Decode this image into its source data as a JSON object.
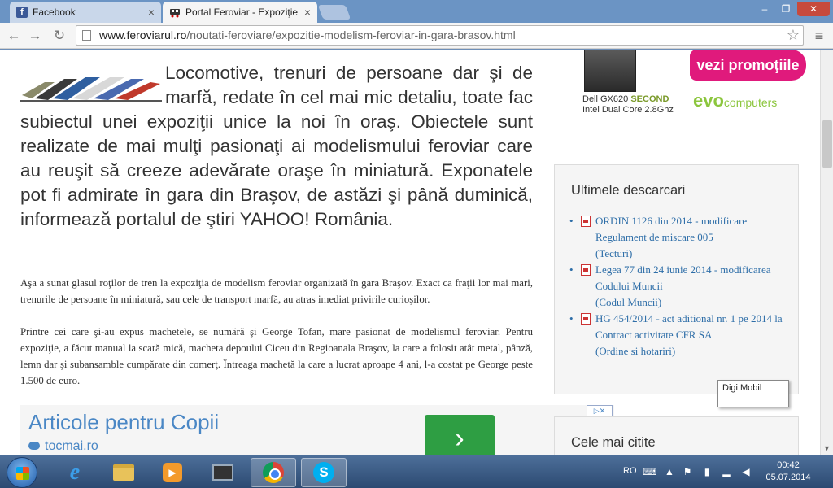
{
  "browser": {
    "tabs": [
      {
        "title": "Facebook",
        "close": "×"
      },
      {
        "title": "Portal Feroviar - Expoziţie",
        "close": "×"
      }
    ],
    "url_domain": "www.feroviarul.ro",
    "url_path": "/noutati-feroviare/expozitie-modelism-feroviar-in-gara-brasov.html",
    "window_controls": {
      "min": "–",
      "max": "❐",
      "close": "✕"
    }
  },
  "article": {
    "lead": "Locomotive, trenuri de persoane dar şi de marfă, redate în cel mai mic detaliu, toate fac subiectul unei expoziţii unice la noi în oraş. Obiectele sunt realizate de mai mulţi pasionaţi ai modelismului feroviar care au reuşit să creeze adevărate oraşe în miniatură. Exponatele pot fi admirate în gara din Braşov, de astăzi şi până duminică, informează portalul de ştiri YAHOO! România.",
    "paragraphs": [
      "Aşa a sunat glasul roţilor de tren la expoziţia de modelism feroviar organizată în gara Braşov. Exact ca fraţii lor mai mari, trenurile de persoane în miniatură, sau cele de transport marfă, au atras imediat privirile curioşilor.",
      "Printre cei care şi-au expus machetele, se numără şi George Tofan, mare pasionat de modelismul feroviar. Pentru expoziţie, a făcut manual la scară mică, macheta depoului Ciceu din Regioanala Braşov, la care a folosit atât metal, pânză, lemn dar şi subansamble cumpărate din comerţ. Întreaga machetă la care a lucrat aproape 4 ani, l-a costat pe George peste 1.500 de euro."
    ]
  },
  "ad": {
    "title": "Articole pentru Copii",
    "source": "tocmai.ro",
    "arrow": "›",
    "choice": "▷✕"
  },
  "promo": {
    "model_prefix": "Dell GX620",
    "model_badge": "SECOND",
    "cpu": "Intel Dual Core 2.8Ghz",
    "cta": "vezi promoţiile",
    "brand": "evo",
    "brand_sub": "computers"
  },
  "sidebar": {
    "downloads_title": "Ultimele descarcari",
    "downloads": [
      {
        "text": "ORDIN 1126 din 2014 - modificare Regulament de miscare 005",
        "category": "(Tecturi)"
      },
      {
        "text": "Legea 77 din 24 iunie 2014 - modificarea Codului Muncii",
        "category": "(Codul Muncii)"
      },
      {
        "text": "HG 454/2014 - act aditional nr. 1 pe 2014 la Contract activitate CFR SA",
        "category": "(Ordine si hotariri)"
      }
    ],
    "popular_title": "Cele mai citite"
  },
  "tooltip": "Digi.Mobil",
  "taskbar": {
    "language": "RO",
    "time": "00:42",
    "date": "05.07.2014"
  }
}
